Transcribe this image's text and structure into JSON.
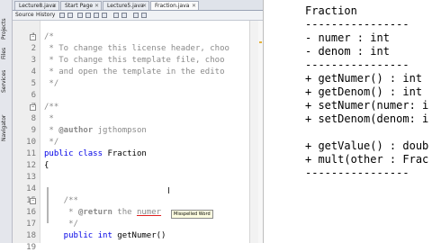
{
  "editor_tabs": [
    {
      "label": "Lecture8.java"
    },
    {
      "label": "Start Page"
    },
    {
      "label": "Lecture5.java"
    },
    {
      "label": "Fraction.java"
    }
  ],
  "toolbar": {
    "source_label": "Source",
    "history_label": "History"
  },
  "side_tabs": [
    {
      "label": "Projects"
    },
    {
      "label": "Files"
    },
    {
      "label": "Services"
    },
    {
      "label": "Navigator"
    }
  ],
  "line_numbers": [
    "1",
    "2",
    "3",
    "4",
    "5",
    "6",
    "7",
    "8",
    "9",
    "10",
    "11",
    "12",
    "13",
    "14",
    "15",
    "16",
    "17",
    "18",
    "19"
  ],
  "code_lines": [
    [
      {
        "t": "/*",
        "c": "comment"
      }
    ],
    [
      {
        "t": " * To change this license header, choo",
        "c": "comment"
      }
    ],
    [
      {
        "t": " * To change this template file, choo",
        "c": "comment"
      }
    ],
    [
      {
        "t": " * and open the template in the edito",
        "c": "comment"
      }
    ],
    [
      {
        "t": " */",
        "c": "comment"
      }
    ],
    [
      {
        "t": "",
        "c": "plain"
      }
    ],
    [
      {
        "t": "/**",
        "c": "comment"
      }
    ],
    [
      {
        "t": " *",
        "c": "comment"
      }
    ],
    [
      {
        "t": " * ",
        "c": "comment"
      },
      {
        "t": "@author",
        "c": "tag"
      },
      {
        "t": " jgthompson",
        "c": "comment"
      }
    ],
    [
      {
        "t": " */",
        "c": "comment"
      }
    ],
    [
      {
        "t": "public class ",
        "c": "kw"
      },
      {
        "t": "Fraction",
        "c": "plain"
      }
    ],
    [
      {
        "t": "{",
        "c": "plain"
      }
    ],
    [
      {
        "t": "",
        "c": "plain"
      }
    ],
    [
      {
        "t": "",
        "c": "plain"
      }
    ],
    [
      {
        "t": "    /**",
        "c": "comment"
      }
    ],
    [
      {
        "t": "     * ",
        "c": "comment"
      },
      {
        "t": "@return",
        "c": "tag"
      },
      {
        "t": " the ",
        "c": "comment"
      },
      {
        "t": "numer",
        "c": "under"
      }
    ],
    [
      {
        "t": "     */",
        "c": "comment"
      }
    ],
    [
      {
        "t": "    public int ",
        "c": "kw"
      },
      {
        "t": "getNumer()",
        "c": "plain"
      }
    ],
    [
      {
        "t": "    {",
        "c": "plain"
      }
    ]
  ],
  "tooltip_text": "Misspelled Word",
  "uml_lines": [
    "Fraction",
    "----------------",
    "- numer : int",
    "- denom : int",
    "----------------",
    "+ getNumer() : int",
    "+ getDenom() : int",
    "+ setNumer(numer: i",
    "+ setDenom(denom: i",
    "",
    "+ getValue() : doub",
    "+ mult(other : Frac",
    "----------------"
  ],
  "colors": {
    "keyword": "#0000e6",
    "comment": "#8a8a8a",
    "tab_bar": "#dfe3ea",
    "gutter": "#eeeeee"
  },
  "icons": [
    "close-icon",
    "fold-toggle-icon",
    "back-icon",
    "forward-icon"
  ]
}
